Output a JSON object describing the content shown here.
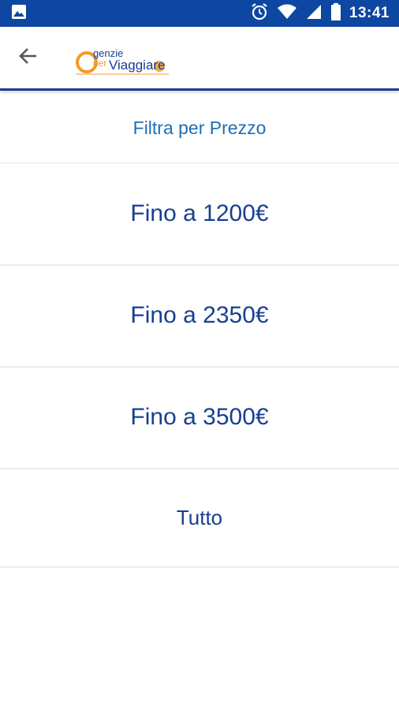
{
  "status_bar": {
    "time": "13:41",
    "icons": [
      "image-icon",
      "alarm-icon",
      "wifi-icon",
      "signal-icon",
      "battery-icon"
    ]
  },
  "app_bar": {
    "back_icon": "arrow-back-icon",
    "logo_text": "agenzie per viaggiare"
  },
  "filter": {
    "title": "Filtra per Prezzo",
    "options": [
      {
        "label": "Fino a 1200€"
      },
      {
        "label": "Fino a 2350€"
      },
      {
        "label": "Fino a 3500€"
      },
      {
        "label": "Tutto"
      }
    ]
  },
  "colors": {
    "status_bar": "#0d47a1",
    "title_text": "#1e6fb8",
    "option_text": "#173f91",
    "appbar_border": "#1a3d8f",
    "logo_orange": "#f39a2b",
    "logo_blue": "#1a3d8f"
  }
}
